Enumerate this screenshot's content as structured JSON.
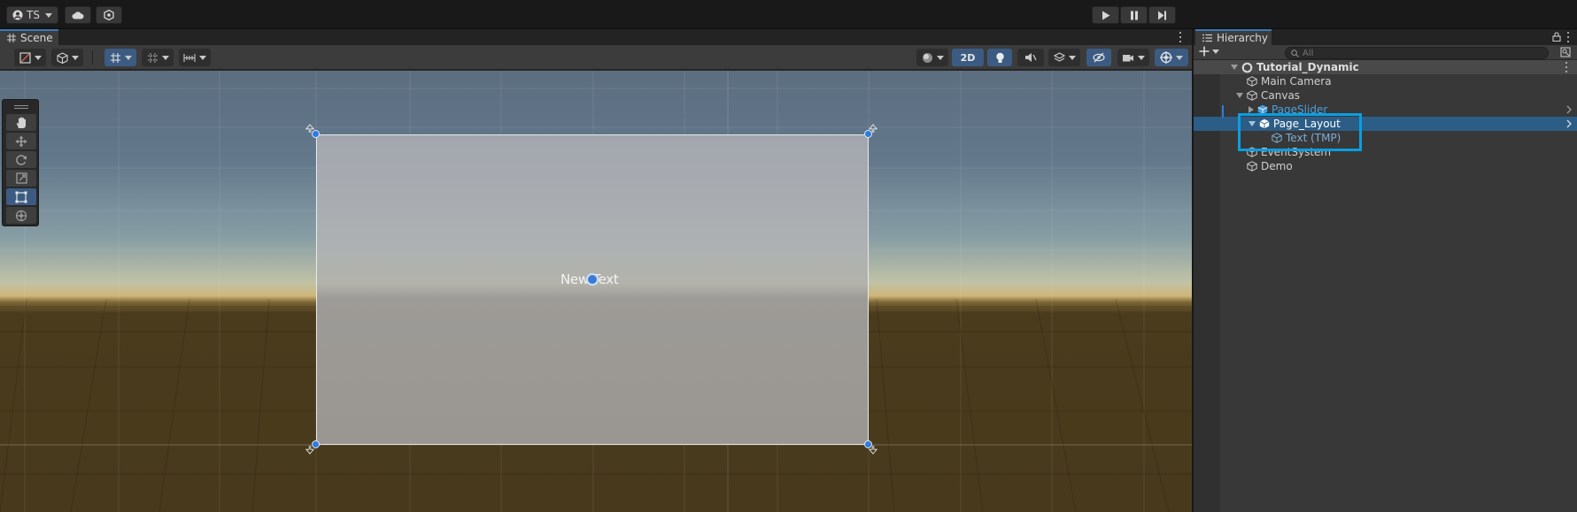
{
  "topbar": {
    "account_label": "TS",
    "icons": [
      "account-icon",
      "cloud-icon",
      "collab-icon",
      "play-icon",
      "pause-icon",
      "step-icon"
    ]
  },
  "scene": {
    "tab_label": "Scene",
    "toolbar": {
      "mode_2d_label": "2D",
      "active_buttons": [
        "2d-toggle",
        "lighting-toggle",
        "hidden-objects-toggle",
        "gizmos-toggle",
        "grid-toggle",
        "rect-tool"
      ]
    },
    "viewport": {
      "canvas_text": "New Text"
    },
    "tools": [
      "hand-tool",
      "move-tool",
      "rotate-tool",
      "scale-tool",
      "rect-tool",
      "transform-tool"
    ],
    "active_tool": "rect-tool"
  },
  "hierarchy": {
    "tab_label": "Hierarchy",
    "search_placeholder": "All",
    "items": [
      {
        "label": "Tutorial_Dynamic",
        "depth": 0,
        "kind": "scene",
        "expanded": true
      },
      {
        "label": "Main Camera",
        "depth": 1,
        "kind": "object"
      },
      {
        "label": "Canvas",
        "depth": 1,
        "kind": "object",
        "expanded": true
      },
      {
        "label": "PageSlider",
        "depth": 2,
        "kind": "prefab",
        "expanded": false
      },
      {
        "label": "Page_Layout",
        "depth": 2,
        "kind": "prefab",
        "expanded": true,
        "selected": true
      },
      {
        "label": "Text (TMP)",
        "depth": 3,
        "kind": "object"
      },
      {
        "label": "EventSystem",
        "depth": 1,
        "kind": "object"
      },
      {
        "label": "Demo",
        "depth": 1,
        "kind": "object"
      }
    ]
  },
  "colors": {
    "accent": "#3a79bb",
    "selection": "#2c5d87",
    "highlight_box": "#0a9fe0",
    "prefab_text": "#4a9fe0"
  }
}
